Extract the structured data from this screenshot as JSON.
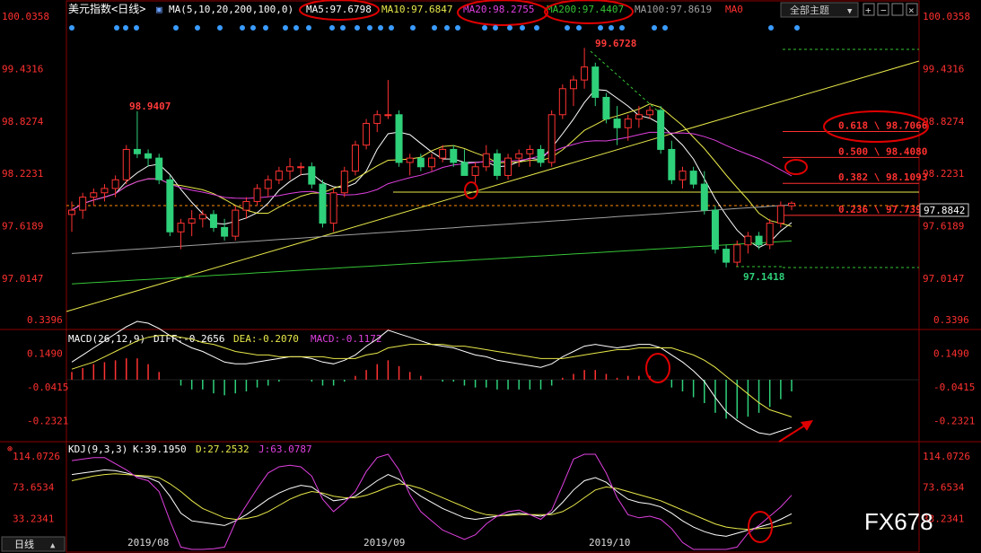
{
  "header": {
    "title": "美元指数",
    "period_bracket": "<日线>",
    "ma_prefix": "MA(5,10,20,200,100,0)",
    "ma5": "MA5:97.6798",
    "ma10": "MA10:97.6847",
    "ma20": "MA20:98.2755",
    "ma200": "MA200:97.4407",
    "ma100": "MA100:97.8619",
    "ma0": "MA0",
    "theme_button": "全部主题"
  },
  "colors": {
    "up": "#ff3232",
    "down": "#2fd07a",
    "ma5": "#ffffff",
    "ma10": "#e8e84a",
    "ma20": "#e040e0",
    "ma200": "#36c436",
    "ma100": "#a0a0a0",
    "axis": "#ff3030",
    "grid": "#8b0000",
    "circle": "#e00000",
    "fib": "#ff3030"
  },
  "price_axis": [
    "100.0358",
    "99.4316",
    "98.8274",
    "98.2231",
    "97.6189",
    "97.0147"
  ],
  "macd_axis": [
    "0.3396",
    "0.1490",
    "-0.0415",
    "-0.2321"
  ],
  "kdj_axis": [
    "114.0726",
    "73.6534",
    "33.2341"
  ],
  "current_price": "97.8842",
  "fib_levels": [
    {
      "label": "0.618 \\ 98.7066",
      "value": 98.7066
    },
    {
      "label": "0.500 \\ 98.4080",
      "value": 98.408
    },
    {
      "label": "0.382 \\ 98.1093",
      "value": 98.1093
    },
    {
      "label": "0.236 \\ 97.7398",
      "value": 97.7398
    }
  ],
  "annotations": {
    "high_left": "98.9407",
    "high_main": "99.6728",
    "low_main": "97.1418"
  },
  "macd_header": {
    "name": "MACD(26,12,9)",
    "diff": "DIFF:-0.2656",
    "dea": "DEA:-0.2070",
    "macd": "MACD:-0.1172"
  },
  "kdj_header": {
    "name": "KDJ(9,3,3)",
    "k": "K:39.1950",
    "d": "D:27.2532",
    "j": "J:63.0787"
  },
  "x_labels": [
    "2019/08",
    "2019/09",
    "2019/10"
  ],
  "bottom_tab": "日线",
  "watermark": "FX678",
  "chart_data": {
    "type": "candlestick",
    "title": "美元指数<日线>",
    "price_range": [
      96.8,
      100.0358
    ],
    "candles": [
      [
        97.75,
        97.9,
        97.55,
        97.8
      ],
      [
        97.8,
        98.0,
        97.7,
        97.95
      ],
      [
        97.95,
        98.05,
        97.85,
        98.0
      ],
      [
        98.0,
        98.1,
        97.9,
        98.05
      ],
      [
        98.05,
        98.2,
        97.95,
        98.15
      ],
      [
        98.15,
        98.55,
        98.1,
        98.5
      ],
      [
        98.5,
        98.94,
        98.4,
        98.45
      ],
      [
        98.45,
        98.5,
        98.3,
        98.4
      ],
      [
        98.4,
        98.45,
        98.1,
        98.15
      ],
      [
        98.15,
        98.2,
        97.5,
        97.55
      ],
      [
        97.55,
        97.7,
        97.35,
        97.65
      ],
      [
        97.65,
        97.8,
        97.5,
        97.7
      ],
      [
        97.7,
        97.8,
        97.6,
        97.75
      ],
      [
        97.75,
        97.8,
        97.55,
        97.6
      ],
      [
        97.6,
        97.7,
        97.45,
        97.5
      ],
      [
        97.5,
        97.85,
        97.45,
        97.8
      ],
      [
        97.8,
        97.95,
        97.7,
        97.9
      ],
      [
        97.9,
        98.1,
        97.85,
        98.05
      ],
      [
        98.05,
        98.2,
        97.95,
        98.15
      ],
      [
        98.15,
        98.3,
        98.1,
        98.25
      ],
      [
        98.25,
        98.4,
        98.15,
        98.3
      ],
      [
        98.3,
        98.35,
        98.2,
        98.3
      ],
      [
        98.3,
        98.35,
        98.05,
        98.1
      ],
      [
        98.1,
        98.15,
        97.6,
        97.65
      ],
      [
        97.65,
        98.05,
        97.55,
        98.0
      ],
      [
        98.0,
        98.3,
        97.95,
        98.25
      ],
      [
        98.25,
        98.6,
        98.2,
        98.55
      ],
      [
        98.55,
        98.85,
        98.5,
        98.8
      ],
      [
        98.8,
        98.95,
        98.7,
        98.9
      ],
      [
        98.9,
        99.3,
        98.85,
        98.9
      ],
      [
        98.9,
        98.95,
        98.3,
        98.35
      ],
      [
        98.35,
        98.45,
        98.2,
        98.4
      ],
      [
        98.4,
        98.45,
        98.25,
        98.3
      ],
      [
        98.3,
        98.45,
        98.25,
        98.4
      ],
      [
        98.4,
        98.55,
        98.35,
        98.5
      ],
      [
        98.5,
        98.55,
        98.3,
        98.35
      ],
      [
        98.35,
        98.5,
        98.2,
        98.2
      ],
      [
        98.2,
        98.35,
        98.1,
        98.3
      ],
      [
        98.3,
        98.55,
        98.25,
        98.45
      ],
      [
        98.45,
        98.5,
        98.15,
        98.2
      ],
      [
        98.2,
        98.45,
        98.15,
        98.4
      ],
      [
        98.4,
        98.5,
        98.3,
        98.45
      ],
      [
        98.45,
        98.55,
        98.3,
        98.5
      ],
      [
        98.5,
        98.55,
        98.3,
        98.35
      ],
      [
        98.35,
        98.95,
        98.3,
        98.9
      ],
      [
        98.9,
        99.25,
        98.85,
        99.2
      ],
      [
        99.2,
        99.35,
        99.0,
        99.3
      ],
      [
        99.3,
        99.67,
        99.2,
        99.45
      ],
      [
        99.45,
        99.5,
        99.0,
        99.1
      ],
      [
        99.1,
        99.15,
        98.8,
        98.85
      ],
      [
        98.85,
        99.0,
        98.55,
        98.75
      ],
      [
        98.75,
        98.9,
        98.6,
        98.85
      ],
      [
        98.85,
        99.0,
        98.75,
        98.9
      ],
      [
        98.9,
        99.0,
        98.85,
        98.95
      ],
      [
        98.95,
        99.0,
        98.45,
        98.5
      ],
      [
        98.5,
        98.6,
        98.1,
        98.15
      ],
      [
        98.15,
        98.3,
        98.05,
        98.25
      ],
      [
        98.25,
        98.3,
        98.05,
        98.1
      ],
      [
        98.1,
        98.25,
        97.75,
        97.8
      ],
      [
        97.8,
        97.85,
        97.3,
        97.35
      ],
      [
        97.35,
        97.4,
        97.14,
        97.2
      ],
      [
        97.2,
        97.45,
        97.15,
        97.4
      ],
      [
        97.4,
        97.55,
        97.3,
        97.5
      ],
      [
        97.5,
        97.55,
        97.35,
        97.4
      ],
      [
        97.4,
        97.7,
        97.35,
        97.65
      ],
      [
        97.65,
        97.9,
        97.6,
        97.85
      ],
      [
        97.85,
        97.9,
        97.8,
        97.88
      ]
    ],
    "horizontal_line": 98.06,
    "dashed_level": 97.88,
    "macd": {
      "diff": [
        0.1,
        0.14,
        0.18,
        0.22,
        0.26,
        0.3,
        0.33,
        0.32,
        0.29,
        0.25,
        0.21,
        0.18,
        0.16,
        0.13,
        0.1,
        0.09,
        0.09,
        0.1,
        0.11,
        0.12,
        0.13,
        0.13,
        0.12,
        0.1,
        0.09,
        0.11,
        0.14,
        0.19,
        0.23,
        0.28,
        0.26,
        0.24,
        0.22,
        0.2,
        0.19,
        0.18,
        0.16,
        0.14,
        0.13,
        0.11,
        0.1,
        0.09,
        0.08,
        0.07,
        0.09,
        0.13,
        0.16,
        0.19,
        0.2,
        0.19,
        0.18,
        0.19,
        0.2,
        0.2,
        0.18,
        0.14,
        0.1,
        0.05,
        -0.01,
        -0.1,
        -0.18,
        -0.23,
        -0.27,
        -0.3,
        -0.31,
        -0.29,
        -0.27
      ],
      "dea": [
        0.06,
        0.08,
        0.1,
        0.13,
        0.16,
        0.19,
        0.22,
        0.24,
        0.25,
        0.25,
        0.24,
        0.23,
        0.21,
        0.2,
        0.18,
        0.16,
        0.15,
        0.14,
        0.14,
        0.13,
        0.13,
        0.13,
        0.13,
        0.13,
        0.12,
        0.12,
        0.12,
        0.14,
        0.15,
        0.18,
        0.19,
        0.2,
        0.2,
        0.2,
        0.2,
        0.19,
        0.19,
        0.18,
        0.17,
        0.16,
        0.15,
        0.14,
        0.13,
        0.12,
        0.12,
        0.12,
        0.13,
        0.14,
        0.15,
        0.16,
        0.17,
        0.17,
        0.18,
        0.18,
        0.18,
        0.18,
        0.16,
        0.14,
        0.11,
        0.07,
        0.02,
        -0.03,
        -0.08,
        -0.13,
        -0.17,
        -0.19,
        -0.21
      ],
      "hist": [
        0.08,
        0.12,
        0.16,
        0.18,
        0.2,
        0.22,
        0.22,
        0.16,
        0.08,
        0.0,
        -0.06,
        -0.1,
        -0.1,
        -0.14,
        -0.16,
        -0.14,
        -0.12,
        -0.08,
        -0.06,
        -0.02,
        0.0,
        0.0,
        -0.02,
        -0.06,
        -0.06,
        -0.02,
        0.04,
        0.1,
        0.16,
        0.2,
        0.14,
        0.08,
        0.04,
        0.0,
        -0.02,
        -0.02,
        -0.06,
        -0.08,
        -0.08,
        -0.1,
        -0.1,
        -0.1,
        -0.1,
        -0.1,
        -0.06,
        0.02,
        0.06,
        0.1,
        0.1,
        0.06,
        0.02,
        0.04,
        0.04,
        0.04,
        0.0,
        -0.08,
        -0.12,
        -0.18,
        -0.24,
        -0.34,
        -0.4,
        -0.4,
        -0.38,
        -0.34,
        -0.28,
        -0.2,
        -0.12
      ]
    },
    "kdj": {
      "k": [
        90,
        92,
        94,
        96,
        95,
        92,
        88,
        86,
        80,
        62,
        40,
        30,
        28,
        26,
        24,
        30,
        38,
        48,
        58,
        66,
        72,
        76,
        74,
        64,
        56,
        58,
        62,
        72,
        82,
        90,
        84,
        72,
        62,
        54,
        46,
        40,
        34,
        32,
        34,
        36,
        38,
        40,
        38,
        36,
        40,
        54,
        70,
        82,
        86,
        80,
        68,
        58,
        54,
        52,
        48,
        40,
        30,
        22,
        16,
        12,
        10,
        14,
        18,
        22,
        26,
        32,
        39.2
      ],
      "d": [
        82,
        85,
        88,
        90,
        91,
        90,
        89,
        88,
        86,
        78,
        68,
        56,
        46,
        40,
        34,
        32,
        33,
        36,
        42,
        50,
        58,
        64,
        68,
        66,
        62,
        60,
        60,
        63,
        68,
        74,
        78,
        76,
        72,
        66,
        60,
        54,
        48,
        42,
        38,
        37,
        37,
        38,
        38,
        38,
        38,
        42,
        50,
        60,
        70,
        74,
        72,
        68,
        64,
        60,
        56,
        50,
        44,
        38,
        32,
        26,
        22,
        20,
        19,
        20,
        21,
        24,
        27.3
      ],
      "j": [
        108,
        110,
        112,
        112,
        104,
        96,
        86,
        82,
        68,
        30,
        -4,
        -10,
        -8,
        -6,
        -4,
        28,
        50,
        72,
        92,
        100,
        102,
        100,
        88,
        58,
        42,
        54,
        68,
        94,
        112,
        118,
        96,
        64,
        42,
        30,
        18,
        12,
        6,
        12,
        26,
        36,
        42,
        44,
        38,
        32,
        44,
        76,
        110,
        120,
        118,
        92,
        60,
        38,
        34,
        36,
        32,
        20,
        2,
        -10,
        -16,
        -18,
        -18,
        -4,
        14,
        24,
        36,
        48,
        63.1
      ]
    }
  }
}
